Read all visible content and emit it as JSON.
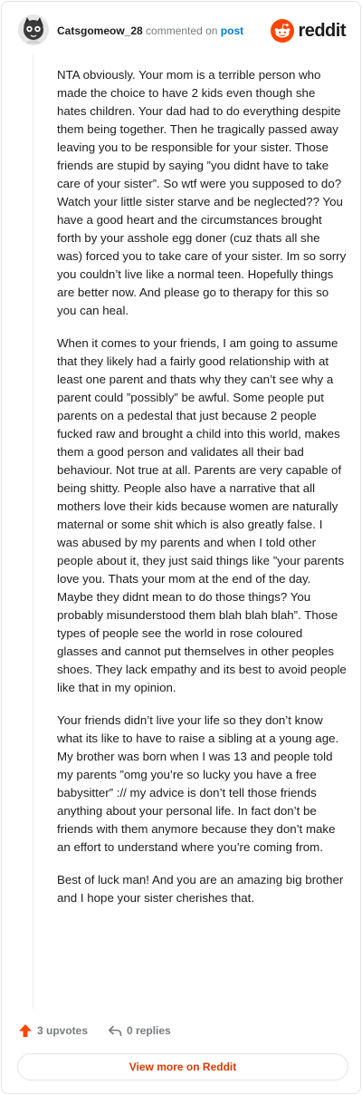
{
  "header": {
    "username": "Catsgomeow_28",
    "commented_text": "commented on",
    "post_link": "post",
    "brand": "reddit",
    "brand_color": "#ff4500"
  },
  "comment": {
    "paragraphs": [
      "NTA obviously. Your mom is a terrible person who made the choice to have 2 kids even though she hates children. Your dad had to do everything despite them being together. Then he tragically passed away leaving you to be responsible for your sister. Those friends are stupid by saying ”you didnt have to take care of your sister”. So wtf were you supposed to do? Watch your little sister starve and be neglected?? You have a good heart and the circumstances brought forth by your asshole egg doner (cuz thats all she was) forced you to take care of your sister. Im so sorry you couldn’t live like a normal teen. Hopefully things are better now. And please go to therapy for this so you can heal.",
      "When it comes to your friends, I am going to assume that they likely had a fairly good relationship with at least one parent and thats why they can’t see why a parent could ”possibly” be awful. Some people put parents on a pedestal that just because 2 people fucked raw and brought a child into this world, makes them a good person and validates all their bad behaviour. Not true at all. Parents are very capable of being shitty. People also have a narrative that all mothers love their kids because women are naturally maternal or some shit which is also greatly false. I was abused by my parents and when I told other people about it, they just said things like ”your parents love you. Thats your mom at the end of the day. Maybe they didnt mean to do those things? You probably misunderstood them blah blah blah”. Those types of people see the world in rose coloured glasses and cannot put themselves in other peoples shoes. They lack empathy and its best to avoid people like that in my opinion.",
      "Your friends didn’t live your life so they don’t know what its like to have to raise a sibling at a young age. My brother was born when I was 13 and people told my parents ”omg you’re so lucky you have a free babysitter” :// my advice is don’t tell those friends anything about your personal life. In fact don’t be friends with them anymore because they don’t make an effort to understand where you’re coming from.",
      "Best of luck man! And you are an amazing big brother and I hope your sister cherishes that."
    ]
  },
  "actions": {
    "upvotes": "3 upvotes",
    "replies": "0 replies",
    "upvote_color": "#ff4500"
  },
  "footer": {
    "view_more": "View more on Reddit",
    "view_more_color": "#d93a00"
  },
  "icons": {
    "avatar": "avatar-icon",
    "brand": "reddit-logo-icon",
    "upvote": "upvote-arrow-icon",
    "reply": "reply-arrow-icon"
  }
}
